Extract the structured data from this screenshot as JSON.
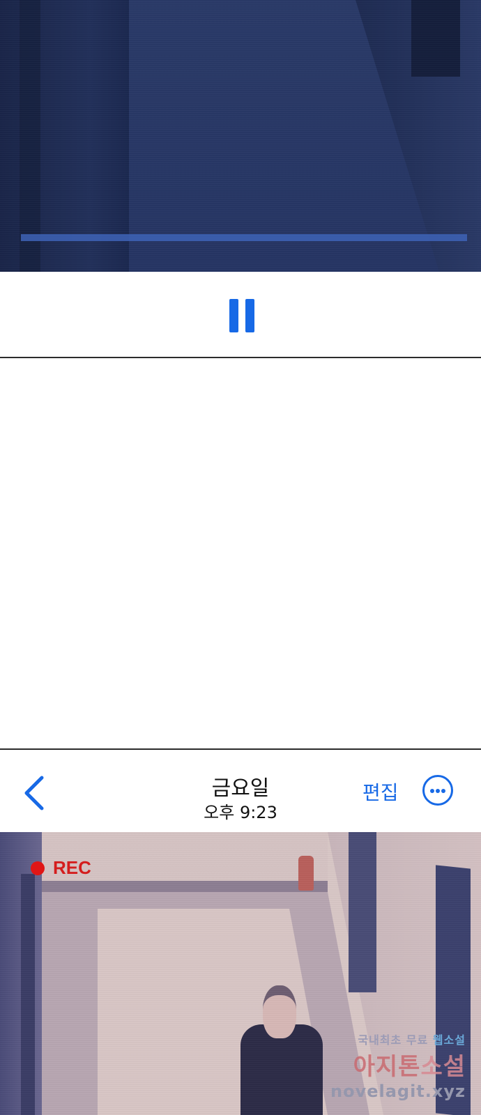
{
  "video_player": {
    "pause_icon": "pause-icon",
    "accent_color": "#1769e6"
  },
  "photo_viewer": {
    "header": {
      "title": "금요일",
      "subtitle": "오후 9:23",
      "edit_label": "편집",
      "back_icon": "chevron-left-icon",
      "more_icon": "ellipsis-circle-icon"
    },
    "photo": {
      "rec_label": "REC",
      "rec_color": "#e01616"
    }
  },
  "watermark": {
    "line1_prefix": "국내최초 무료",
    "line1_highlight": "웹소설",
    "line2_prefix": "아지톤",
    "line2_highlight": "소설",
    "line3": "novelagit.xyz"
  }
}
